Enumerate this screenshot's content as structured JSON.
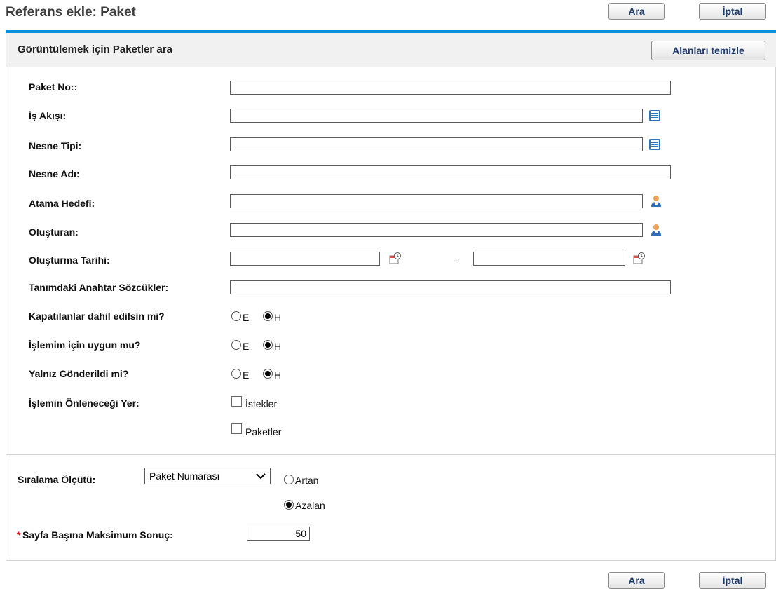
{
  "header": {
    "title": "Referans ekle: Paket",
    "search_label": "Ara",
    "cancel_label": "İptal"
  },
  "panel": {
    "title": "Görüntülemek için Paketler ara",
    "clear_label": "Alanları temizle"
  },
  "fields": {
    "package_no": {
      "label": "Paket No::",
      "value": ""
    },
    "workflow": {
      "label": "İş Akışı:",
      "value": ""
    },
    "object_type": {
      "label": "Nesne Tipi:",
      "value": ""
    },
    "object_name": {
      "label": "Nesne Adı:",
      "value": ""
    },
    "assigned_to": {
      "label": "Atama Hedefi:",
      "value": ""
    },
    "created_by": {
      "label": "Oluşturan:",
      "value": ""
    },
    "creation_date": {
      "label": "Oluşturma Tarihi:",
      "from": "",
      "to": "",
      "separator": "-"
    },
    "keywords": {
      "label": "Tanımdaki Anahtar Sözcükler:",
      "value": ""
    },
    "include_closed": {
      "label": "Kapatılanlar dahil edilsin mi?",
      "yes": "E",
      "no": "H",
      "selected": "H"
    },
    "actionable": {
      "label": "İşlemim için uygun mu?",
      "yes": "E",
      "no": "H",
      "selected": "H"
    },
    "only_submitted": {
      "label": "Yalnız Gönderildi mi?",
      "yes": "E",
      "no": "H",
      "selected": "H"
    },
    "block_location": {
      "label": "İşlemin Önleneceği Yer:",
      "options": [
        "İstekler",
        "Paketler"
      ]
    }
  },
  "sort": {
    "label": "Sıralama Ölçütü:",
    "selected": "Paket Numarası",
    "asc": "Artan",
    "desc": "Azalan",
    "direction": "Azalan"
  },
  "max_results": {
    "required_mark": "*",
    "label": "Sayfa Başına Maksimum Sonuç:",
    "value": "50"
  },
  "footer": {
    "search_label": "Ara",
    "cancel_label": "İptal"
  }
}
